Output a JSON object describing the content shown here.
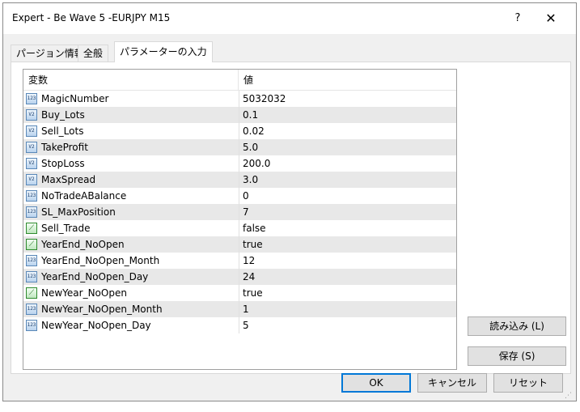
{
  "window": {
    "title": "Expert - Be Wave 5 -EURJPY M15",
    "help": "?",
    "close": "✕"
  },
  "tabs": [
    {
      "label": "パージョン情報"
    },
    {
      "label": "全般"
    },
    {
      "label": "パラメーターの入力"
    }
  ],
  "grid": {
    "headers": {
      "variable": "変数",
      "value": "値"
    },
    "rows": [
      {
        "name": "MagicNumber",
        "value": "5032032",
        "icon": "int-123-icon"
      },
      {
        "name": "Buy_Lots",
        "value": "0.1",
        "icon": "double-v2-icon"
      },
      {
        "name": "Sell_Lots",
        "value": "0.02",
        "icon": "double-v2-icon"
      },
      {
        "name": "TakeProfit",
        "value": "5.0",
        "icon": "double-v2-icon"
      },
      {
        "name": "StopLoss",
        "value": "200.0",
        "icon": "double-v2-icon"
      },
      {
        "name": "MaxSpread",
        "value": "3.0",
        "icon": "double-v2-icon"
      },
      {
        "name": "NoTradeABalance",
        "value": "0",
        "icon": "int-123-icon"
      },
      {
        "name": "SL_MaxPosition",
        "value": "7",
        "icon": "int-123-icon"
      },
      {
        "name": "Sell_Trade",
        "value": "false",
        "icon": "bool-icon"
      },
      {
        "name": "YearEnd_NoOpen",
        "value": "true",
        "icon": "bool-icon"
      },
      {
        "name": "YearEnd_NoOpen_Month",
        "value": "12",
        "icon": "int-123-icon"
      },
      {
        "name": "YearEnd_NoOpen_Day",
        "value": "24",
        "icon": "int-123-icon"
      },
      {
        "name": "NewYear_NoOpen",
        "value": "true",
        "icon": "bool-icon"
      },
      {
        "name": "NewYear_NoOpen_Month",
        "value": "1",
        "icon": "int-123-icon"
      },
      {
        "name": "NewYear_NoOpen_Day",
        "value": "5",
        "icon": "int-123-icon"
      }
    ]
  },
  "buttons": {
    "load": "読み込み (L)",
    "save": "保存 (S)",
    "ok": "OK",
    "cancel": "キャンセル",
    "reset": "リセット"
  },
  "colors": {
    "default_button_border": "#0078d7",
    "row_alt": "#e8e8e8"
  }
}
